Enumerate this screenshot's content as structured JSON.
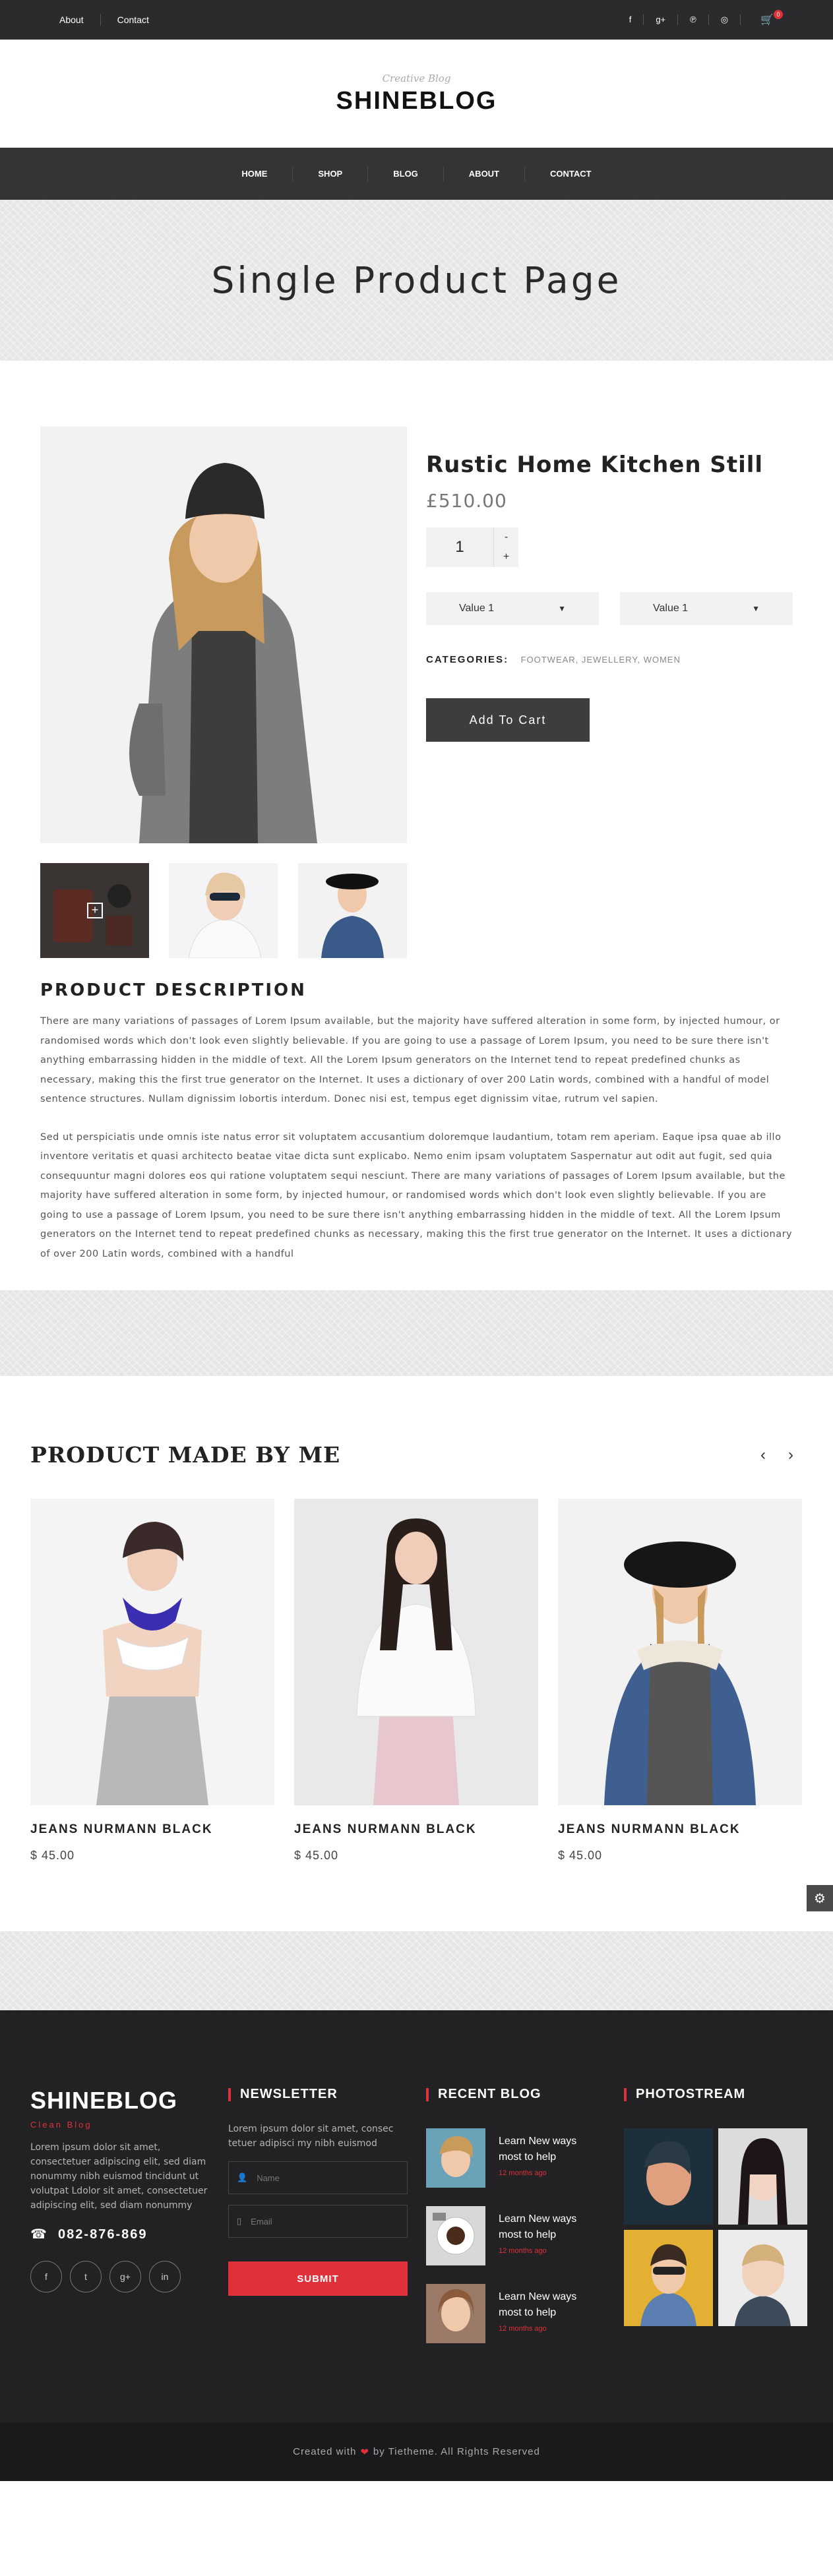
{
  "topbar": {
    "links": [
      "About",
      "Contact"
    ],
    "social_icons": [
      "facebook-icon",
      "google-plus-icon",
      "pinterest-icon",
      "dribbble-icon"
    ],
    "cart_count": "0"
  },
  "logo": {
    "tagline": "Creative Blog",
    "name": "SHINEBLOG"
  },
  "nav": {
    "items": [
      "HOME",
      "SHOP",
      "BLOG",
      "ABOUT",
      "CONTACT"
    ]
  },
  "hero": {
    "title": "Single Product Page"
  },
  "product": {
    "title": "Rustic Home Kitchen Still",
    "price": "£510.00",
    "quantity": "1",
    "qty_minus": "-",
    "qty_plus": "+",
    "select1": "Value 1",
    "select2": "Value 1",
    "categories_label": "CATEGORIES:",
    "categories": [
      "FOOTWEAR",
      "JEWELLERY",
      "WOMEN"
    ],
    "add_to_cart": "Add To Cart"
  },
  "description": {
    "heading": "PRODUCT DESCRIPTION",
    "p1": "There are many variations of passages of Lorem Ipsum available, but the majority have suffered alteration in some form, by injected humour, or randomised words which don't look even slightly believable. If you are going to use a passage of Lorem Ipsum, you need to be sure there isn't anything embarrassing hidden in the middle of text. All the Lorem Ipsum generators on the Internet tend to repeat predefined chunks as necessary, making this the first true generator on the Internet. It uses a dictionary of over 200 Latin words, combined with a handful of model sentence structures. Nullam dignissim lobortis interdum. Donec nisi est, tempus eget dignissim vitae, rutrum vel sapien.",
    "p2": "Sed ut perspiciatis unde omnis iste natus error sit voluptatem accusantium doloremque laudantium, totam rem aperiam. Eaque ipsa quae ab illo inventore veritatis et quasi architecto beatae vitae dicta sunt explicabo. Nemo enim ipsam voluptatem Saspernatur aut odit aut fugit, sed quia consequuntur magni dolores eos qui ratione voluptatem sequi nesciunt. There are many variations of passages of Lorem Ipsum available, but the majority have suffered alteration in some form, by injected humour, or randomised words which don't look even slightly believable. If you are going to use a passage of Lorem Ipsum, you need to be sure there isn't anything embarrassing hidden in the middle of text. All the Lorem Ipsum generators on the Internet tend to repeat predefined chunks as necessary, making this the first true generator on the Internet. It uses a dictionary of over 200 Latin words, combined with a handful"
  },
  "made": {
    "heading": "PRODUCT MADE BY ME",
    "prev": "‹",
    "next": "›",
    "cards": [
      {
        "title": "JEANS NURMANN BLACK",
        "price": "$ 45.00"
      },
      {
        "title": "JEANS NURMANN BLACK",
        "price": "$ 45.00"
      },
      {
        "title": "JEANS NURMANN BLACK",
        "price": "$ 45.00"
      }
    ]
  },
  "footer": {
    "brand": {
      "name": "SHINEBLOG",
      "sub": "Clean Blog",
      "text": "Lorem ipsum dolor sit amet, consectetuer adipiscing elit, sed diam nonummy nibh euismod tincidunt ut volutpat Ldolor sit amet, consectetuer adipiscing elit, sed diam nonummy",
      "phone": "082-876-869",
      "social": [
        "f",
        "t",
        "g+",
        "in"
      ]
    },
    "newsletter": {
      "heading": "NEWSLETTER",
      "text": "Lorem ipsum dolor sit amet, consec tetuer adipisci my nibh euismod",
      "name_placeholder": "Name",
      "email_placeholder": "Email",
      "submit": "SUBMIT"
    },
    "recent_blog": {
      "heading": "RECENT BLOG",
      "items": [
        {
          "title": "Learn New ways most to help",
          "date": "12 months ago"
        },
        {
          "title": "Learn New ways most to help",
          "date": "12 months ago"
        },
        {
          "title": "Learn New ways most to help",
          "date": "12 months ago"
        }
      ]
    },
    "photostream": {
      "heading": "PHOTOSTREAM"
    },
    "copyright_pre": "Created with",
    "copyright_post": "by Tietheme. All Rights Reserved"
  },
  "colors": {
    "accent": "#e0303a",
    "dark": "#2b2b2d",
    "nav": "#343436"
  }
}
